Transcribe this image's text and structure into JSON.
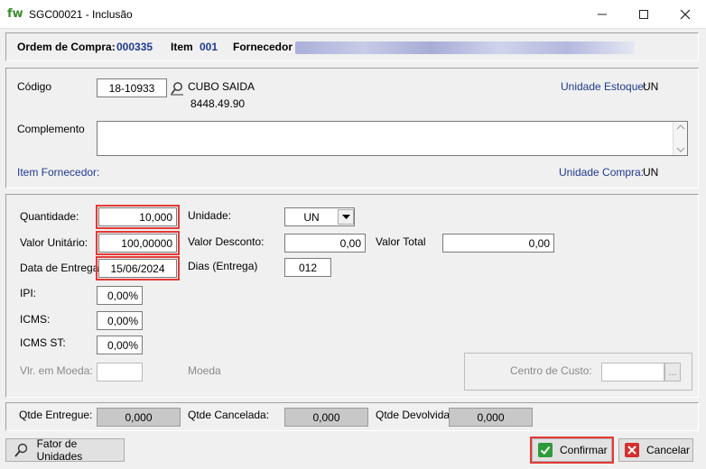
{
  "window": {
    "logo": "fw",
    "title": "SGC00021 - Inclusão",
    "controls": [
      "minimize",
      "maximize",
      "close"
    ]
  },
  "header": {
    "ordem_label": "Ordem de Compra:",
    "ordem_value": "000335",
    "item_label": "Item",
    "item_value": "001",
    "fornecedor_label": "Fornecedor"
  },
  "product": {
    "codigo_label": "Código",
    "codigo_value": "18-10933",
    "description": "CUBO SAIDA",
    "ref": "8448.49.90",
    "unidade_estoque_label": "Unidade Estoque:",
    "unidade_estoque_value": "UN",
    "complemento_label": "Complemento",
    "complemento_value": "",
    "item_fornecedor_label": "Item Fornecedor:",
    "unidade_compra_label": "Unidade Compra:",
    "unidade_compra_value": "UN"
  },
  "values": {
    "quantidade_label": "Quantidade:",
    "quantidade_value": "10,000",
    "valor_unitario_label": "Valor Unitário:",
    "valor_unitario_value": "100,00000",
    "data_entrega_label": "Data de Entrega",
    "data_entrega_value": "15/06/2024",
    "unidade_label": "Unidade:",
    "unidade_value": "UN",
    "valor_desconto_label": "Valor Desconto:",
    "valor_desconto_value": "0,00",
    "valor_total_label": "Valor Total",
    "valor_total_value": "0,00",
    "dias_label": "Dias (Entrega)",
    "dias_value": "012",
    "ipi_label": "IPI:",
    "ipi_value": "0,00%",
    "icms_label": "ICMS:",
    "icms_value": "0,00%",
    "icms_st_label": "ICMS ST:",
    "icms_st_value": "0,00%",
    "vlr_moeda_label": "Vlr. em Moeda:",
    "vlr_moeda_value": "",
    "moeda_label": "Moeda",
    "centro_custo_label": "Centro de Custo:",
    "centro_custo_value": "",
    "centro_custo_btn": "..."
  },
  "totals": {
    "entregue_label": "Qtde Entregue:",
    "entregue_value": "0,000",
    "cancelada_label": "Qtde Cancelada:",
    "cancelada_value": "0,000",
    "devolvida_label": "Qtde Devolvida:",
    "devolvida_value": "0,000"
  },
  "buttons": {
    "fator_unidades": "Fator de Unidades",
    "confirmar": "Confirmar",
    "cancelar": "Cancelar"
  },
  "colors": {
    "accent_blue": "#1f3a93",
    "highlight_red": "#e53935",
    "logo_green": "#3b8c2a"
  }
}
